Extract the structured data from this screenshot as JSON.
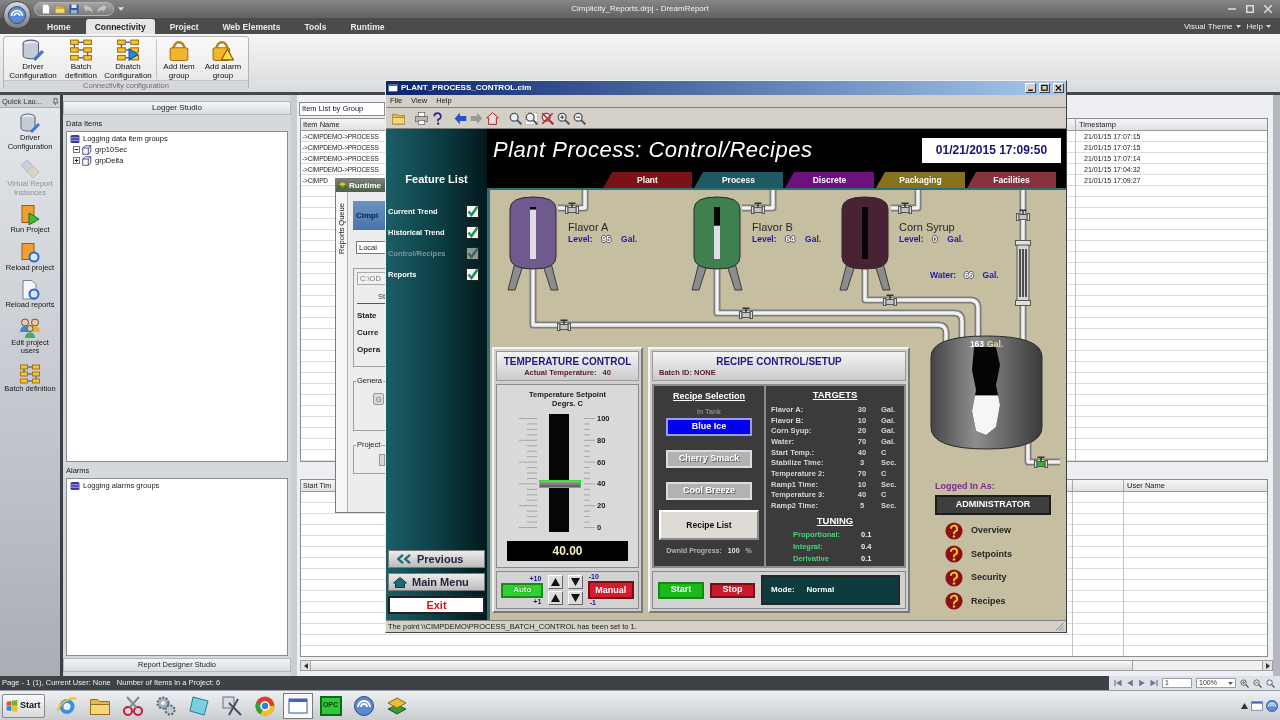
{
  "app": {
    "title": "Cimplicity_Reports.drpj - DreamReport"
  },
  "ribbon": {
    "tabs": [
      {
        "label": "Home",
        "selected": false
      },
      {
        "label": "Connectivity",
        "selected": true
      },
      {
        "label": "Project",
        "selected": false
      },
      {
        "label": "Web Elements",
        "selected": false
      },
      {
        "label": "Tools",
        "selected": false
      },
      {
        "label": "Runtime",
        "selected": false
      }
    ],
    "menus": [
      "Visual Theme",
      "Help"
    ],
    "group": {
      "label": "Connectivity configuration",
      "sections": [
        [
          {
            "label": "Driver Configuration",
            "kind": "driver"
          },
          {
            "label": "Batch definition",
            "kind": "batch"
          },
          {
            "label": "Dbatch Configuration",
            "kind": "dbatch"
          }
        ],
        [
          {
            "label": "Add item group",
            "kind": "item_group"
          },
          {
            "label": "Add alarm group",
            "kind": "alarm_group"
          }
        ]
      ]
    }
  },
  "quick_launch": {
    "title": "Quick Lau...",
    "items": [
      {
        "label": "Driver Configuration",
        "kind": "driver",
        "disabled": false
      },
      {
        "label": "Virtual Report Instances",
        "kind": "instances",
        "disabled": true
      },
      {
        "label": "Run Project",
        "kind": "run",
        "disabled": false
      },
      {
        "label": "Reload project",
        "kind": "reload_project",
        "disabled": false
      },
      {
        "label": "Reload reports",
        "kind": "reload_reports",
        "disabled": false
      },
      {
        "label": "Edit project users",
        "kind": "users",
        "disabled": false
      },
      {
        "label": "Batch definition",
        "kind": "batch",
        "disabled": false
      }
    ]
  },
  "logger": {
    "title": "Logger Studio",
    "data_items": {
      "label": "Data Items",
      "tree": [
        {
          "label": "Logging data item groups",
          "children": [
            {
              "label": "grp10Sec",
              "expanded": true
            },
            {
              "label": "grpDelta",
              "expanded": false
            }
          ]
        }
      ]
    },
    "alarms": {
      "label": "Alarms",
      "tree": [
        {
          "label": "Logging alarms groups"
        }
      ]
    },
    "footer": "Report Designer Studio"
  },
  "item_list": {
    "view": "Item List by Group",
    "columns": [
      "Item Name",
      "Timestamp"
    ],
    "rows": [
      {
        "item_name": "->CIMPDEMO->PROCESS",
        "timestamp": "21/01/15 17:07:15"
      },
      {
        "item_name": "->CIMPDEMO->PROCESS",
        "timestamp": "21/01/15 17:07:15"
      },
      {
        "item_name": "->CIMPDEMO->PROCESS",
        "timestamp": "21/01/15 17:07:14"
      },
      {
        "item_name": "->CIMPDEMO->PROCESS",
        "timestamp": "21/01/15 17:04:32"
      },
      {
        "item_name": "->CIMPD",
        "timestamp": "21/01/15 17:09:27"
      }
    ]
  },
  "alarm_table": {
    "columns": [
      "Start Tim",
      "User Name"
    ]
  },
  "runtime_window": {
    "title": "Runtime",
    "tab": "Reports Queue",
    "banner": "Cimpl",
    "host": "Local",
    "path": "C:\\OD",
    "status_heading": "St",
    "labels": [
      "State",
      "Curre",
      "Opera"
    ],
    "groups": [
      {
        "label": "Genera",
        "button": "G"
      },
      {
        "label": "Project"
      }
    ]
  },
  "hmi": {
    "title": "PLANT_PROCESS_CONTROL.cim",
    "menu": [
      "File",
      "View",
      "Help"
    ],
    "header": {
      "title": "Plant Process: Control/Recipes",
      "datetime": "01/21/2015 17:09:50"
    },
    "feature_list": {
      "title": "Feature List",
      "items": [
        {
          "label": "Current Trend",
          "checked": true,
          "disabled": false
        },
        {
          "label": "Historical Trend",
          "checked": true,
          "disabled": false
        },
        {
          "label": "Control/Recipes",
          "checked": true,
          "disabled": true
        },
        {
          "label": "Reports",
          "checked": true,
          "disabled": false
        }
      ]
    },
    "nav_buttons": [
      {
        "label": "Previous",
        "kind": "previous"
      },
      {
        "label": "Main Menu",
        "kind": "home"
      },
      {
        "label": "Exit",
        "kind": "exit"
      }
    ],
    "tabs": [
      {
        "label": "Plant",
        "color": "#7a1216"
      },
      {
        "label": "Process",
        "color": "#1d5a62"
      },
      {
        "label": "Discrete",
        "color": "#6c127e"
      },
      {
        "label": "Packaging",
        "color": "#86721e"
      },
      {
        "label": "Facilities",
        "color": "#883240"
      }
    ],
    "tanks": [
      {
        "name": "Flavor A",
        "level_label": "Level:",
        "value": "95",
        "unit": "Gal.",
        "level": 0.95,
        "color": "#6e5a8c"
      },
      {
        "name": "Flavor B",
        "level_label": "Level:",
        "value": "64",
        "unit": "Gal.",
        "level": 0.64,
        "color": "#3f8050"
      },
      {
        "name": "Corn Syrup",
        "level_label": "Level:",
        "value": "0",
        "unit": "Gal.",
        "color": "#4a2236"
      }
    ],
    "water": {
      "label": "Water:",
      "value": "66",
      "unit": "Gal."
    },
    "mix_tank": {
      "value": "163",
      "unit": "Gal.",
      "level": 0.45,
      "outlet_open": true
    },
    "temperature": {
      "title": "TEMPERATURE CONTROL",
      "actual_label": "Actual Temperature:",
      "actual": "40",
      "setpoint_title": "Temperature Setpoint",
      "setpoint_unit": "Degrs. C",
      "scale": [
        "100",
        "80",
        "60",
        "40",
        "20",
        "0"
      ],
      "level": 0.4,
      "display": "40.00",
      "coarse_up": "+10",
      "coarse_down": "-10",
      "fine_up": "+1",
      "fine_down": "-1",
      "modes": [
        {
          "label": "Auto",
          "kind": "auto",
          "active": false
        },
        {
          "label": "Manual",
          "kind": "manual",
          "active": true
        }
      ]
    },
    "recipe": {
      "title": "RECIPE CONTROL/SETUP",
      "batch": "Batch ID: NONE",
      "selection_title": "Recipe Selection",
      "in_tank": "In Tank",
      "recipes": [
        {
          "label": "Blue Ice",
          "selected": true
        },
        {
          "label": "Cherry Smack",
          "selected": false
        },
        {
          "label": "Cool Breeze",
          "selected": false
        }
      ],
      "list_button": "Recipe List",
      "progress_label": "Dwnld Progress:",
      "progress": "100",
      "progress_unit": "%",
      "targets_title": "TARGETS",
      "targets": [
        {
          "label": "Flavor A:",
          "value": "30",
          "unit": "Gal."
        },
        {
          "label": "Flavor B:",
          "value": "10",
          "unit": "Gal."
        },
        {
          "label": "Corn Syup:",
          "value": "20",
          "unit": "Gal."
        },
        {
          "label": "Water:",
          "value": "70",
          "unit": "Gal."
        },
        {
          "label": "Start Temp.:",
          "value": "40",
          "unit": "C"
        },
        {
          "label": "Stabilize Time:",
          "value": "3",
          "unit": "Sec."
        },
        {
          "label": "Temperature 2:",
          "value": "70",
          "unit": "C"
        },
        {
          "label": "Ramp1 Time:",
          "value": "10",
          "unit": "Sec."
        },
        {
          "label": "Temperature 3:",
          "value": "40",
          "unit": "C"
        },
        {
          "label": "Ramp2 Time:",
          "value": "5",
          "unit": "Sec."
        }
      ],
      "tuning_title": "TUNING",
      "tuning": [
        {
          "label": "Proportional:",
          "value": "0.1"
        },
        {
          "label": "Integral:",
          "value": "0.4"
        },
        {
          "label": "Derivative",
          "value": "0.1"
        }
      ],
      "start": "Start",
      "stop": "Stop",
      "mode_label": "Mode:",
      "mode": "Normal"
    },
    "login": {
      "label": "Logged In As:",
      "user": "ADMINISTRATOR",
      "links": [
        "Overview",
        "Setpoints",
        "Security",
        "Recipes"
      ]
    },
    "status": "The point \\\\CIMPDEMO\\PROCESS_BATCH_CONTROL has been set to 1."
  },
  "status_bar": {
    "page": "Page - 1 (1), Current User: None",
    "items": "Number of Items in a Project: 6",
    "page_field": "1",
    "zoom": "100%"
  },
  "taskbar": {
    "start": "Start",
    "apps": [
      {
        "kind": "e_browser",
        "active": false
      },
      {
        "kind": "folder",
        "active": false
      },
      {
        "kind": "scissors",
        "active": false
      },
      {
        "kind": "gears",
        "active": false
      },
      {
        "kind": "notepad",
        "active": false
      },
      {
        "kind": "tools",
        "active": false
      },
      {
        "kind": "ring_browser",
        "active": false
      },
      {
        "kind": "window",
        "active": true
      },
      {
        "kind": "opc",
        "label": "OPC",
        "active": false
      },
      {
        "kind": "swirl",
        "active": false
      },
      {
        "kind": "stack",
        "active": false
      }
    ]
  }
}
